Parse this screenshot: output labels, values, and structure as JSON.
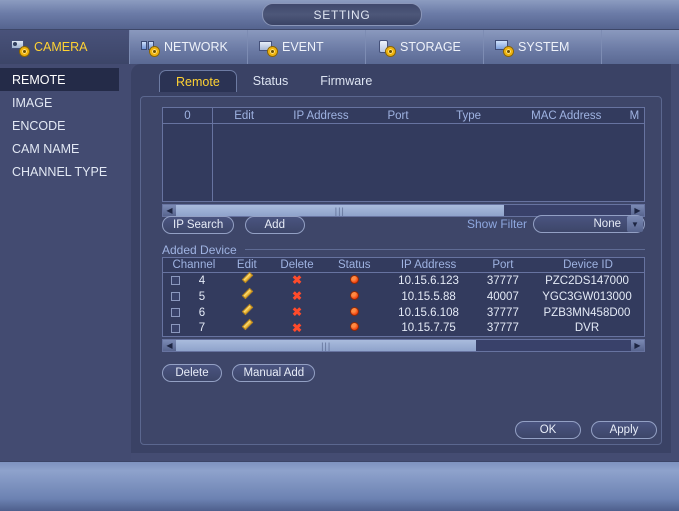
{
  "window": {
    "title": "SETTING"
  },
  "main_tabs": [
    {
      "label": "CAMERA",
      "icon": "camera-icon",
      "active": true
    },
    {
      "label": "NETWORK",
      "icon": "network-icon",
      "active": false
    },
    {
      "label": "EVENT",
      "icon": "event-icon",
      "active": false
    },
    {
      "label": "STORAGE",
      "icon": "storage-icon",
      "active": false
    },
    {
      "label": "SYSTEM",
      "icon": "system-icon",
      "active": false
    }
  ],
  "sidebar": {
    "items": [
      {
        "label": "REMOTE",
        "active": true
      },
      {
        "label": "IMAGE",
        "active": false
      },
      {
        "label": "ENCODE",
        "active": false
      },
      {
        "label": "CAM NAME",
        "active": false
      },
      {
        "label": "CHANNEL TYPE",
        "active": false
      }
    ]
  },
  "sub_tabs": [
    {
      "label": "Remote",
      "active": true
    },
    {
      "label": "Status",
      "active": false
    },
    {
      "label": "Firmware",
      "active": false
    }
  ],
  "discover_table": {
    "headers": [
      "0",
      "Edit",
      "IP Address",
      "Port",
      "Type",
      "MAC Address",
      "M"
    ],
    "rows": []
  },
  "discover_actions": {
    "ip_search_label": "IP Search",
    "add_label": "Add",
    "show_filter_label": "Show Filter",
    "filter_value": "None"
  },
  "added_device": {
    "section_title": "Added Device",
    "headers": [
      "Channel",
      "Edit",
      "Delete",
      "Status",
      "IP Address",
      "Port",
      "Device ID"
    ],
    "rows": [
      {
        "checked": false,
        "channel": "4",
        "edit": "pencil-icon",
        "delete": "x-icon",
        "status": "offline",
        "ip": "10.15.6.123",
        "port": "37777",
        "device_id": "PZC2DS147000"
      },
      {
        "checked": false,
        "channel": "5",
        "edit": "pencil-icon",
        "delete": "x-icon",
        "status": "offline",
        "ip": "10.15.5.88",
        "port": "40007",
        "device_id": "YGC3GW013000"
      },
      {
        "checked": false,
        "channel": "6",
        "edit": "pencil-icon",
        "delete": "x-icon",
        "status": "offline",
        "ip": "10.15.6.108",
        "port": "37777",
        "device_id": "PZB3MN458D00"
      },
      {
        "checked": false,
        "channel": "7",
        "edit": "pencil-icon",
        "delete": "x-icon",
        "status": "offline",
        "ip": "10.15.7.75",
        "port": "37777",
        "device_id": "DVR"
      }
    ],
    "delete_label": "Delete",
    "manual_add_label": "Manual Add"
  },
  "dialog_buttons": {
    "ok_label": "OK",
    "apply_label": "Apply"
  },
  "colors": {
    "accent_yellow": "#ffd233",
    "panel_bg": "#3a4265",
    "table_bg": "#333b5e",
    "header_text": "#9fb3e2",
    "status_offline": "#f13a0d",
    "edit_icon": "#e8a81d",
    "delete_icon": "#ff4b2b"
  }
}
